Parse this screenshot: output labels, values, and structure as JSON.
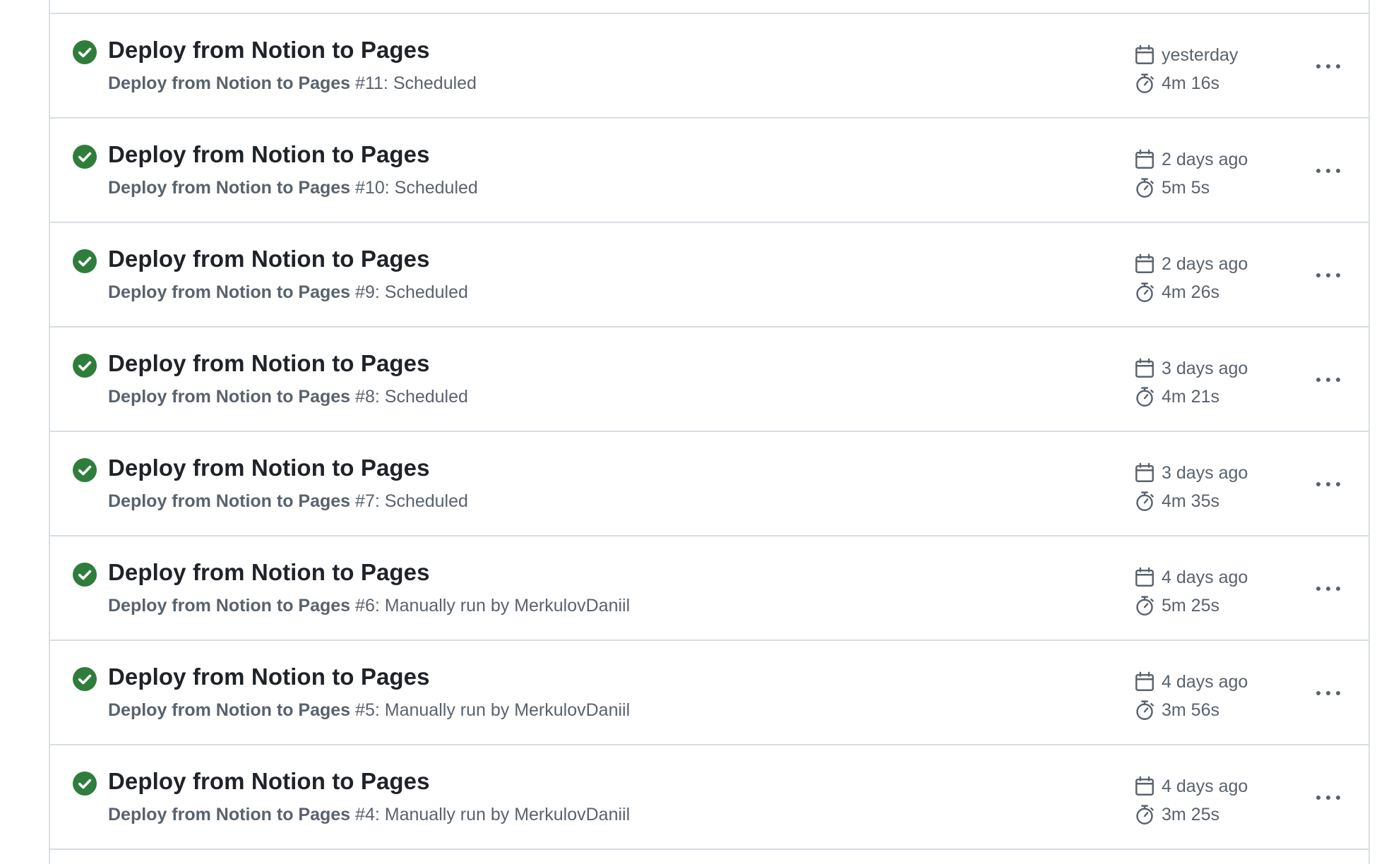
{
  "runs": [
    {
      "title": "Deploy from Notion to Pages",
      "workflow": "Deploy from Notion to Pages",
      "run_number": "#11",
      "event": "Scheduled",
      "date": "yesterday",
      "duration": "4m 16s",
      "status": "success"
    },
    {
      "title": "Deploy from Notion to Pages",
      "workflow": "Deploy from Notion to Pages",
      "run_number": "#10",
      "event": "Scheduled",
      "date": "2 days ago",
      "duration": "5m 5s",
      "status": "success"
    },
    {
      "title": "Deploy from Notion to Pages",
      "workflow": "Deploy from Notion to Pages",
      "run_number": "#9",
      "event": "Scheduled",
      "date": "2 days ago",
      "duration": "4m 26s",
      "status": "success"
    },
    {
      "title": "Deploy from Notion to Pages",
      "workflow": "Deploy from Notion to Pages",
      "run_number": "#8",
      "event": "Scheduled",
      "date": "3 days ago",
      "duration": "4m 21s",
      "status": "success"
    },
    {
      "title": "Deploy from Notion to Pages",
      "workflow": "Deploy from Notion to Pages",
      "run_number": "#7",
      "event": "Scheduled",
      "date": "3 days ago",
      "duration": "4m 35s",
      "status": "success"
    },
    {
      "title": "Deploy from Notion to Pages",
      "workflow": "Deploy from Notion to Pages",
      "run_number": "#6",
      "event": "Manually run by MerkulovDaniil",
      "date": "4 days ago",
      "duration": "5m 25s",
      "status": "success"
    },
    {
      "title": "Deploy from Notion to Pages",
      "workflow": "Deploy from Notion to Pages",
      "run_number": "#5",
      "event": "Manually run by MerkulovDaniil",
      "date": "4 days ago",
      "duration": "3m 56s",
      "status": "success"
    },
    {
      "title": "Deploy from Notion to Pages",
      "workflow": "Deploy from Notion to Pages",
      "run_number": "#4",
      "event": "Manually run by MerkulovDaniil",
      "date": "4 days ago",
      "duration": "3m 25s",
      "status": "success"
    }
  ],
  "icons": {
    "status": "check-circle-fill-icon",
    "date": "calendar-icon",
    "duration": "stopwatch-icon",
    "menu": "kebab-horizontal-icon"
  },
  "colors": {
    "success": "#1a7f37",
    "border": "#d8dee4",
    "muted_text": "#59636e",
    "title_text": "#1f2328"
  }
}
